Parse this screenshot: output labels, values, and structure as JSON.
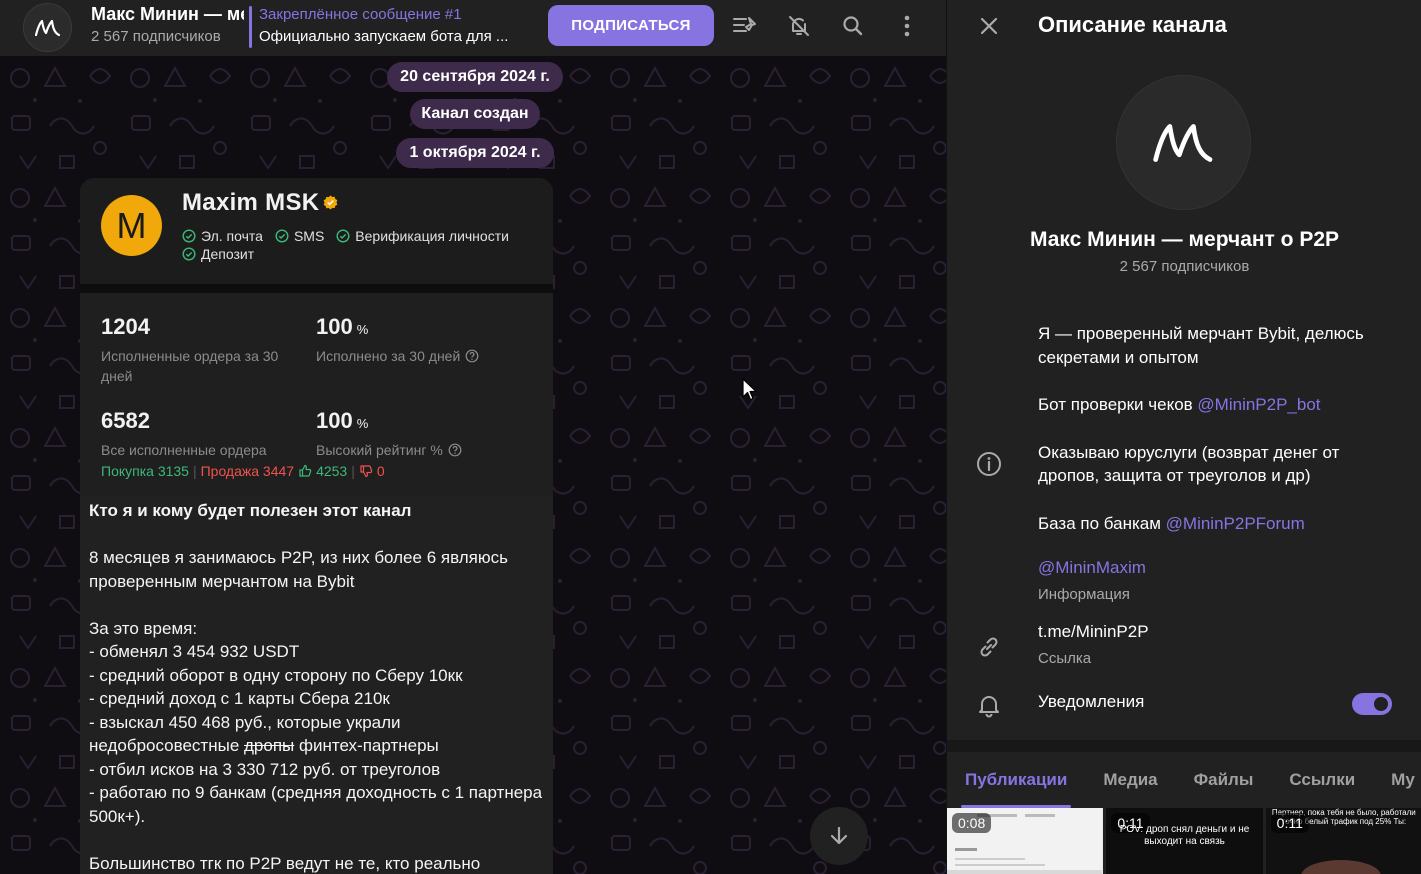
{
  "header": {
    "title": "Макс Минин — ме",
    "subscribers": "2 567 подписчиков",
    "pinned_title": "Закреплённое сообщение #1",
    "pinned_text": "Официально запускаем бота для ...",
    "subscribe_label": "ПОДПИСАТЬСЯ",
    "icons": [
      "pinned-list-icon",
      "mute-icon",
      "search-icon",
      "more-icon"
    ]
  },
  "chat": {
    "date_1": "20 сентября 2024 г.",
    "service_created": "Канал создан",
    "date_2": "1 октября 2024 г.",
    "card": {
      "avatar_letter": "M",
      "name": "Maxim MSK",
      "verifications": [
        "Эл. почта",
        "SMS",
        "Верификация личности",
        "Депозит"
      ],
      "stat1_value": "1204",
      "stat1_label": "Исполненные ордера за 30 дней",
      "stat2_value": "100",
      "stat2_unit": "%",
      "stat2_label": "Исполнено за 30 дней",
      "stat3_value": "6582",
      "stat3_label": "Все исполненные ордера",
      "stat4_value": "100",
      "stat4_unit": "%",
      "stat4_label": "Высокий рейтинг %",
      "buy": "Покупка 3135",
      "sell": "Продажа 3447",
      "likes": "4253",
      "dislikes": "0"
    },
    "message": {
      "heading": "Кто я и кому будет полезен этот канал",
      "p1": "8 месяцев я занимаюсь P2P, из них более 6 являюсь проверенным мерчантом на Bybit",
      "p2_intro": "За это время:",
      "line1": "- обменял 3 454 932 USDT",
      "line2": "- средний оборот в одну сторону по Сберу 10кк",
      "line3": "- средний доход с 1 карты Сбера 210к",
      "line4a": "- взыскал 450 468 руб., которые украли недобросовестные ",
      "line4_strike": "дропы",
      "line4b": " финтех-партнеры",
      "line5": "- отбил исков на 3 330 712 руб. от треуголов",
      "line6": "- работаю по 9 банкам (средняя доходность с 1 партнера 500к+).",
      "p3": "Большинство тгк по P2P ведут не те, кто реально"
    }
  },
  "panel": {
    "title": "Описание канала",
    "channel_name": "Макс Минин — мерчант о P2P",
    "subscribers": "2 567 подписчиков",
    "desc1": "Я — проверенный мерчант Bybit, делюсь секретами и опытом",
    "desc2_text": "Бот проверки чеков ",
    "desc2_link": "@MininP2P_bot",
    "desc3": "Оказываю юруслуги (возврат денег от дропов, защита от треуголов и др)",
    "desc4_text": "База по банкам ",
    "desc4_link": "@MininP2PForum",
    "info_handle": "@MininMaxim",
    "info_label": "Информация",
    "link": "t.me/MininP2P",
    "link_label": "Ссылка",
    "notifications": "Уведомления",
    "notifications_on": true,
    "tabs": [
      "Публикации",
      "Медиа",
      "Файлы",
      "Ссылки",
      "Му"
    ],
    "active_tab": "Публикации",
    "media": [
      {
        "duration": "0:08",
        "caption": ""
      },
      {
        "duration": "0:11",
        "caption": "POV: дроп снял деньги и не выходит на связь"
      },
      {
        "duration": "0:11",
        "caption": "Партнер, пока тебя не было, работали точно белый трафик под 25% Ты:"
      }
    ]
  },
  "colors": {
    "accent": "#8774e1",
    "chip": "#3e2a4a",
    "avatar_yellow": "#f0a80a",
    "green": "#3cb979",
    "red": "#f0524d"
  }
}
